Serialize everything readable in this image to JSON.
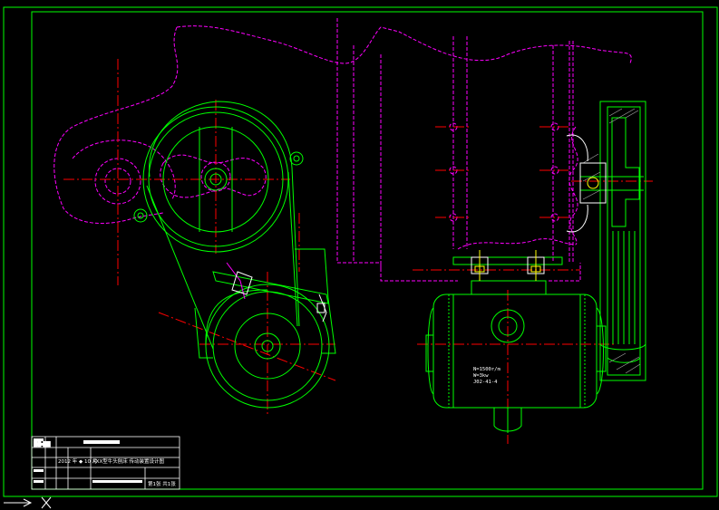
{
  "colors": {
    "background": "#000000",
    "frame": "#00ff00",
    "geometry": "#00ff00",
    "hidden": "#ff00ff",
    "centerline": "#ff0000",
    "text": "#ffffff",
    "highlight": "#ffff00"
  },
  "motor_label": {
    "line1": "N=1500r/m",
    "line2": "W=3kw",
    "line3": "J02-41-4"
  },
  "title_block": {
    "header_cell": "██ ██",
    "title_left": "2012 年 ◆ 10 月",
    "title_main": "XXX型牛头刨床  传动装置设计图",
    "footer_left": "",
    "footer_right": "第1张 共1张"
  },
  "icons": {
    "ucs_icon": "ucs-axis-icon"
  }
}
